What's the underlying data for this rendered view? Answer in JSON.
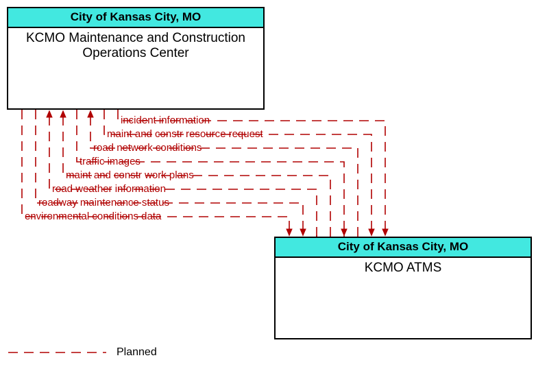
{
  "nodes": {
    "top": {
      "header": "City of Kansas City, MO",
      "body": "KCMO Maintenance and Construction Operations Center"
    },
    "bottom": {
      "header": "City of Kansas City, MO",
      "body": "KCMO ATMS"
    }
  },
  "flows": [
    "incident information",
    "maint and constr resource request",
    "road network conditions",
    "traffic images",
    "maint and constr work plans",
    "road weather information",
    "roadway maintenance status",
    "environmental conditions data"
  ],
  "legend": {
    "planned": "Planned"
  },
  "colors": {
    "header_bg": "#42e8e0",
    "line": "#b00000"
  }
}
